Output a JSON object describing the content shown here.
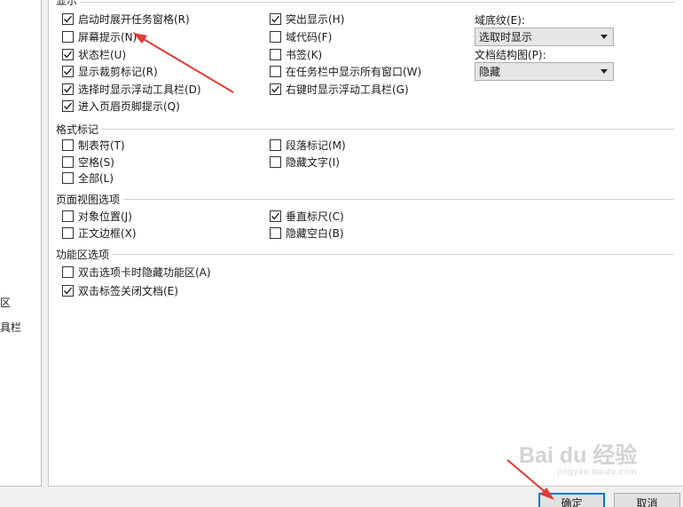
{
  "left_nav": {
    "item1_fragment": "区",
    "item2_fragment": "具栏"
  },
  "display": {
    "header": "显示",
    "left_column": [
      {
        "label": "启动时展开任务窗格(R)",
        "checked": true
      },
      {
        "label": "屏幕提示(N)",
        "checked": false
      },
      {
        "label": "状态栏(U)",
        "checked": true
      },
      {
        "label": "显示裁剪标记(R)",
        "checked": true
      },
      {
        "label": "选择时显示浮动工具栏(D)",
        "checked": true
      },
      {
        "label": "进入页眉页脚提示(Q)",
        "checked": true
      }
    ],
    "mid_column": [
      {
        "label": "突出显示(H)",
        "checked": true
      },
      {
        "label": "域代码(F)",
        "checked": false
      },
      {
        "label": "书签(K)",
        "checked": false
      },
      {
        "label": "在任务栏中显示所有窗口(W)",
        "checked": false
      },
      {
        "label": "右键时显示浮动工具栏(G)",
        "checked": true
      }
    ],
    "field_shading_label": "域底纹(E):",
    "field_shading_value": "选取时显示",
    "doc_map_label": "文档结构图(P):",
    "doc_map_value": "隐藏"
  },
  "format_marks": {
    "header": "格式标记",
    "items": [
      {
        "label": "制表符(T)",
        "checked": false
      },
      {
        "label": "段落标记(M)",
        "checked": false
      },
      {
        "label": "空格(S)",
        "checked": false
      },
      {
        "label": "隐藏文字(I)",
        "checked": false
      },
      {
        "label": "全部(L)",
        "checked": false
      }
    ]
  },
  "page_view": {
    "header": "页面视图选项",
    "items": [
      {
        "label": "对象位置(J)",
        "checked": false
      },
      {
        "label": "垂直标尺(C)",
        "checked": true
      },
      {
        "label": "正文边框(X)",
        "checked": false
      },
      {
        "label": "隐藏空白(B)",
        "checked": false
      }
    ]
  },
  "ribbon": {
    "header": "功能区选项",
    "items": [
      {
        "label": "双击选项卡时隐藏功能区(A)",
        "checked": false
      },
      {
        "label": "双击标签关闭文档(E)",
        "checked": true
      }
    ]
  },
  "buttons": {
    "ok": "确定",
    "cancel": "取消"
  },
  "watermark": {
    "brand": "Bai du 经验",
    "sub": "jingyan.baidu.com"
  },
  "colors": {
    "accent": "#0078d7",
    "annotation_arrow": "#e53935"
  }
}
